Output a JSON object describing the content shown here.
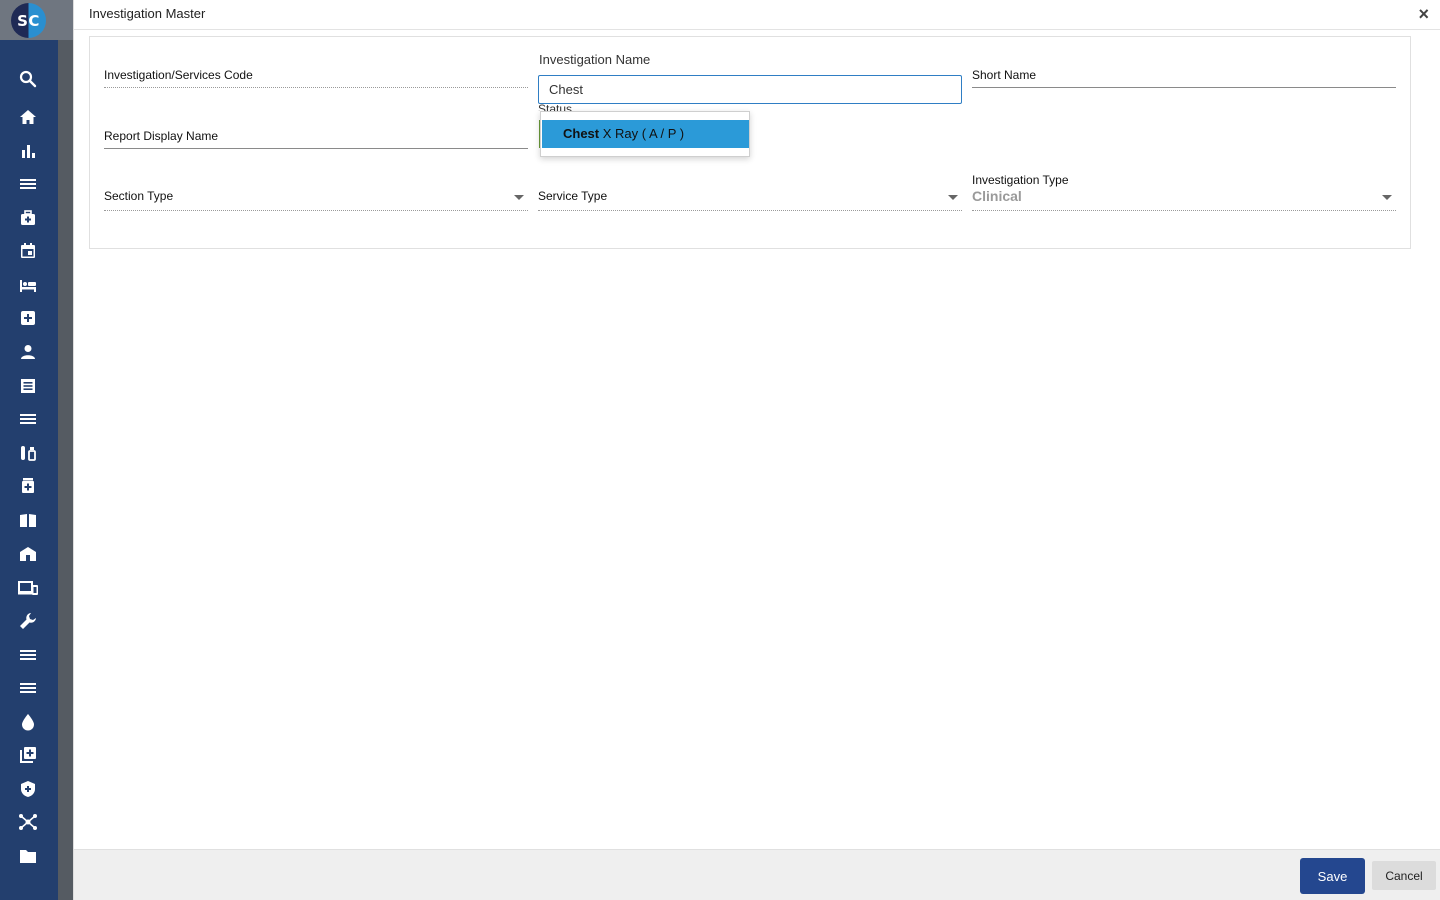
{
  "app": {
    "logo_text": "SC"
  },
  "sidebar": {
    "icons": [
      "search-icon",
      "home-icon",
      "bar-chart-icon",
      "menu-icon",
      "medical-bag-icon",
      "calendar-icon",
      "bed-icon",
      "plus-box-icon",
      "person-icon",
      "receipt-icon",
      "menu-icon",
      "test-tubes-icon",
      "pharmacy-icon",
      "book-icon",
      "store-icon",
      "devices-icon",
      "wrench-icon",
      "menu-icon",
      "menu-icon",
      "drop-icon",
      "library-add-icon",
      "shield-icon",
      "hub-icon",
      "folder-icon"
    ]
  },
  "modal": {
    "title": "Investigation Master",
    "close_glyph": "×",
    "fields": {
      "code_label": "Investigation/Services Code",
      "name_label": "Investigation Name",
      "name_value": "Chest",
      "short_name_label": "Short Name",
      "report_display_label": "Report Display Name",
      "status_label": "Status",
      "section_type_label": "Section Type",
      "service_type_label": "Service Type",
      "investigation_type_label": "Investigation Type",
      "investigation_type_value": "Clinical"
    },
    "autocomplete": {
      "match": "Chest",
      "rest": " X Ray ( A / P )"
    },
    "footer": {
      "save_label": "Save",
      "cancel_label": "Cancel"
    }
  },
  "colors": {
    "sidebar": "#233f6e",
    "accent": "#2b9ad8",
    "save_button": "#24478f",
    "input_border": "#2f7ec4"
  }
}
